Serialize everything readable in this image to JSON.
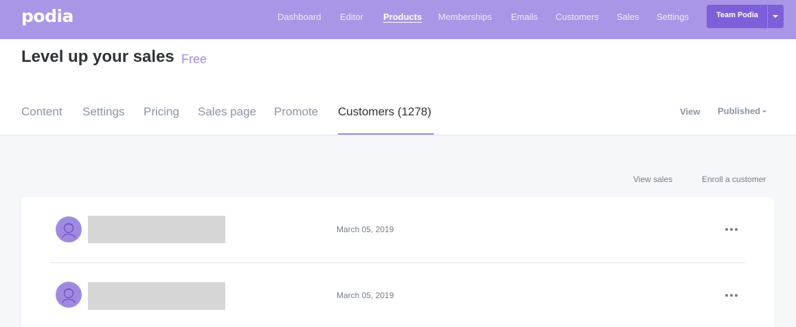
{
  "topbar": {
    "logo": "podia",
    "nav": [
      {
        "label": "Dashboard",
        "active": false
      },
      {
        "label": "Editor",
        "active": false
      },
      {
        "label": "Products",
        "active": true
      },
      {
        "label": "Memberships",
        "active": false
      },
      {
        "label": "Emails",
        "active": false
      },
      {
        "label": "Customers",
        "active": false
      },
      {
        "label": "Sales",
        "active": false
      },
      {
        "label": "Settings",
        "active": false
      }
    ],
    "team_button": {
      "label": "Team Podia",
      "icon": "chevron-down-icon"
    },
    "background_color": "#aa96e6",
    "button_color": "#7d5fd9"
  },
  "product": {
    "title": "Level up your sales",
    "plan": "Free",
    "tabs": [
      {
        "label": "Content",
        "active": false
      },
      {
        "label": "Settings",
        "active": false
      },
      {
        "label": "Pricing",
        "active": false
      },
      {
        "label": "Sales page",
        "active": false
      },
      {
        "label": "Promote",
        "active": false
      },
      {
        "label": "Customers (1278)",
        "active": true
      }
    ],
    "view_label": "View",
    "status": {
      "label": "Published",
      "icon": "caret-down-icon"
    },
    "accent_color": "#a08ae0"
  },
  "actions": {
    "view_sales": "View sales",
    "enroll": "Enroll a customer"
  },
  "customers": [
    {
      "name": "",
      "date": "March 05, 2019",
      "avatar_icon": "user-avatar-icon",
      "menu_icon": "more-horizontal-icon"
    },
    {
      "name": "",
      "date": "March 05, 2019",
      "avatar_icon": "user-avatar-icon",
      "menu_icon": "more-horizontal-icon"
    }
  ]
}
